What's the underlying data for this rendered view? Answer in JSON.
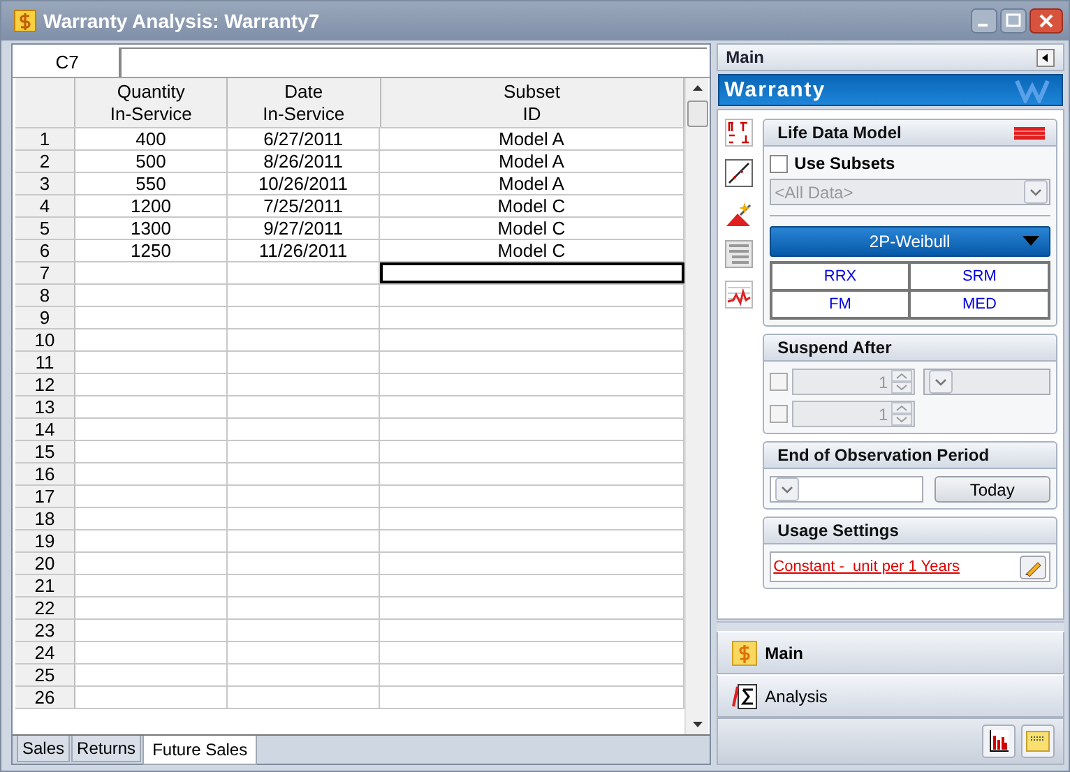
{
  "window": {
    "title": "Warranty Analysis: Warranty7"
  },
  "grid": {
    "cell_ref": "C7",
    "columns": [
      {
        "line1": "Quantity",
        "line2": "In-Service"
      },
      {
        "line1": "Date",
        "line2": "In-Service"
      },
      {
        "line1": "Subset",
        "line2": "ID"
      }
    ],
    "rows": [
      {
        "number": "1",
        "cells": [
          {
            "text": "400",
            "selected": false
          },
          {
            "text": "6/27/2011",
            "selected": false
          },
          {
            "text": "Model A",
            "selected": false
          }
        ]
      },
      {
        "number": "2",
        "cells": [
          {
            "text": "500",
            "selected": false
          },
          {
            "text": "8/26/2011",
            "selected": false
          },
          {
            "text": "Model A",
            "selected": false
          }
        ]
      },
      {
        "number": "3",
        "cells": [
          {
            "text": "550",
            "selected": false
          },
          {
            "text": "10/26/2011",
            "selected": false
          },
          {
            "text": "Model A",
            "selected": false
          }
        ]
      },
      {
        "number": "4",
        "cells": [
          {
            "text": "1200",
            "selected": false
          },
          {
            "text": "7/25/2011",
            "selected": false
          },
          {
            "text": "Model C",
            "selected": false
          }
        ]
      },
      {
        "number": "5",
        "cells": [
          {
            "text": "1300",
            "selected": false
          },
          {
            "text": "9/27/2011",
            "selected": false
          },
          {
            "text": "Model C",
            "selected": false
          }
        ]
      },
      {
        "number": "6",
        "cells": [
          {
            "text": "1250",
            "selected": false
          },
          {
            "text": "11/26/2011",
            "selected": false
          },
          {
            "text": "Model C",
            "selected": false
          }
        ]
      },
      {
        "number": "7",
        "cells": [
          {
            "selected": false
          },
          {
            "selected": false
          },
          {
            "selected": true
          }
        ]
      },
      {
        "number": "8",
        "cells": [
          {
            "selected": false
          },
          {
            "selected": false
          },
          {
            "selected": false
          }
        ]
      },
      {
        "number": "9",
        "cells": [
          {
            "selected": false
          },
          {
            "selected": false
          },
          {
            "selected": false
          }
        ]
      },
      {
        "number": "10",
        "cells": [
          {
            "selected": false
          },
          {
            "selected": false
          },
          {
            "selected": false
          }
        ]
      },
      {
        "number": "11",
        "cells": [
          {
            "selected": false
          },
          {
            "selected": false
          },
          {
            "selected": false
          }
        ]
      },
      {
        "number": "12",
        "cells": [
          {
            "selected": false
          },
          {
            "selected": false
          },
          {
            "selected": false
          }
        ]
      },
      {
        "number": "13",
        "cells": [
          {
            "selected": false
          },
          {
            "selected": false
          },
          {
            "selected": false
          }
        ]
      },
      {
        "number": "14",
        "cells": [
          {
            "selected": false
          },
          {
            "selected": false
          },
          {
            "selected": false
          }
        ]
      },
      {
        "number": "15",
        "cells": [
          {
            "selected": false
          },
          {
            "selected": false
          },
          {
            "selected": false
          }
        ]
      },
      {
        "number": "16",
        "cells": [
          {
            "selected": false
          },
          {
            "selected": false
          },
          {
            "selected": false
          }
        ]
      },
      {
        "number": "17",
        "cells": [
          {
            "selected": false
          },
          {
            "selected": false
          },
          {
            "selected": false
          }
        ]
      },
      {
        "number": "18",
        "cells": [
          {
            "selected": false
          },
          {
            "selected": false
          },
          {
            "selected": false
          }
        ]
      },
      {
        "number": "19",
        "cells": [
          {
            "selected": false
          },
          {
            "selected": false
          },
          {
            "selected": false
          }
        ]
      },
      {
        "number": "20",
        "cells": [
          {
            "selected": false
          },
          {
            "selected": false
          },
          {
            "selected": false
          }
        ]
      },
      {
        "number": "21",
        "cells": [
          {
            "selected": false
          },
          {
            "selected": false
          },
          {
            "selected": false
          }
        ]
      },
      {
        "number": "22",
        "cells": [
          {
            "selected": false
          },
          {
            "selected": false
          },
          {
            "selected": false
          }
        ]
      },
      {
        "number": "23",
        "cells": [
          {
            "selected": false
          },
          {
            "selected": false
          },
          {
            "selected": false
          }
        ]
      },
      {
        "number": "24",
        "cells": [
          {
            "selected": false
          },
          {
            "selected": false
          },
          {
            "selected": false
          }
        ]
      },
      {
        "number": "25",
        "cells": [
          {
            "selected": false
          },
          {
            "selected": false
          },
          {
            "selected": false
          }
        ]
      },
      {
        "number": "26",
        "cells": [
          {
            "selected": false
          },
          {
            "selected": false
          },
          {
            "selected": false
          }
        ]
      }
    ]
  },
  "sheet_tabs": [
    {
      "label": "Sales",
      "selected": false
    },
    {
      "label": "Returns",
      "selected": false
    },
    {
      "label": "Future Sales",
      "selected": true
    }
  ],
  "panel": {
    "title": "Main",
    "banner": "Warranty",
    "life_data_model": {
      "title": "Life Data Model",
      "use_subsets": {
        "label": "Use Subsets",
        "checked": false
      },
      "subset_dropdown": {
        "value": "<All Data>",
        "disabled": true
      },
      "distribution": "2P-Weibull",
      "methods": [
        "RRX",
        "SRM",
        "FM",
        "MED"
      ]
    },
    "suspend_after": {
      "title": "Suspend After",
      "rows": [
        {
          "checked": false,
          "value": "1",
          "disabled": true
        },
        {
          "checked": false,
          "value": "1",
          "disabled": true
        }
      ]
    },
    "end_of_observation": {
      "title": "End of Observation Period",
      "button": "Today"
    },
    "usage_settings": {
      "title": "Usage Settings",
      "link": "Constant -  unit per 1 Years"
    }
  },
  "nav": [
    {
      "label": "Main",
      "selected": true,
      "kind": "dollar"
    },
    {
      "label": "Analysis",
      "selected": false,
      "kind": "sigma"
    }
  ]
}
